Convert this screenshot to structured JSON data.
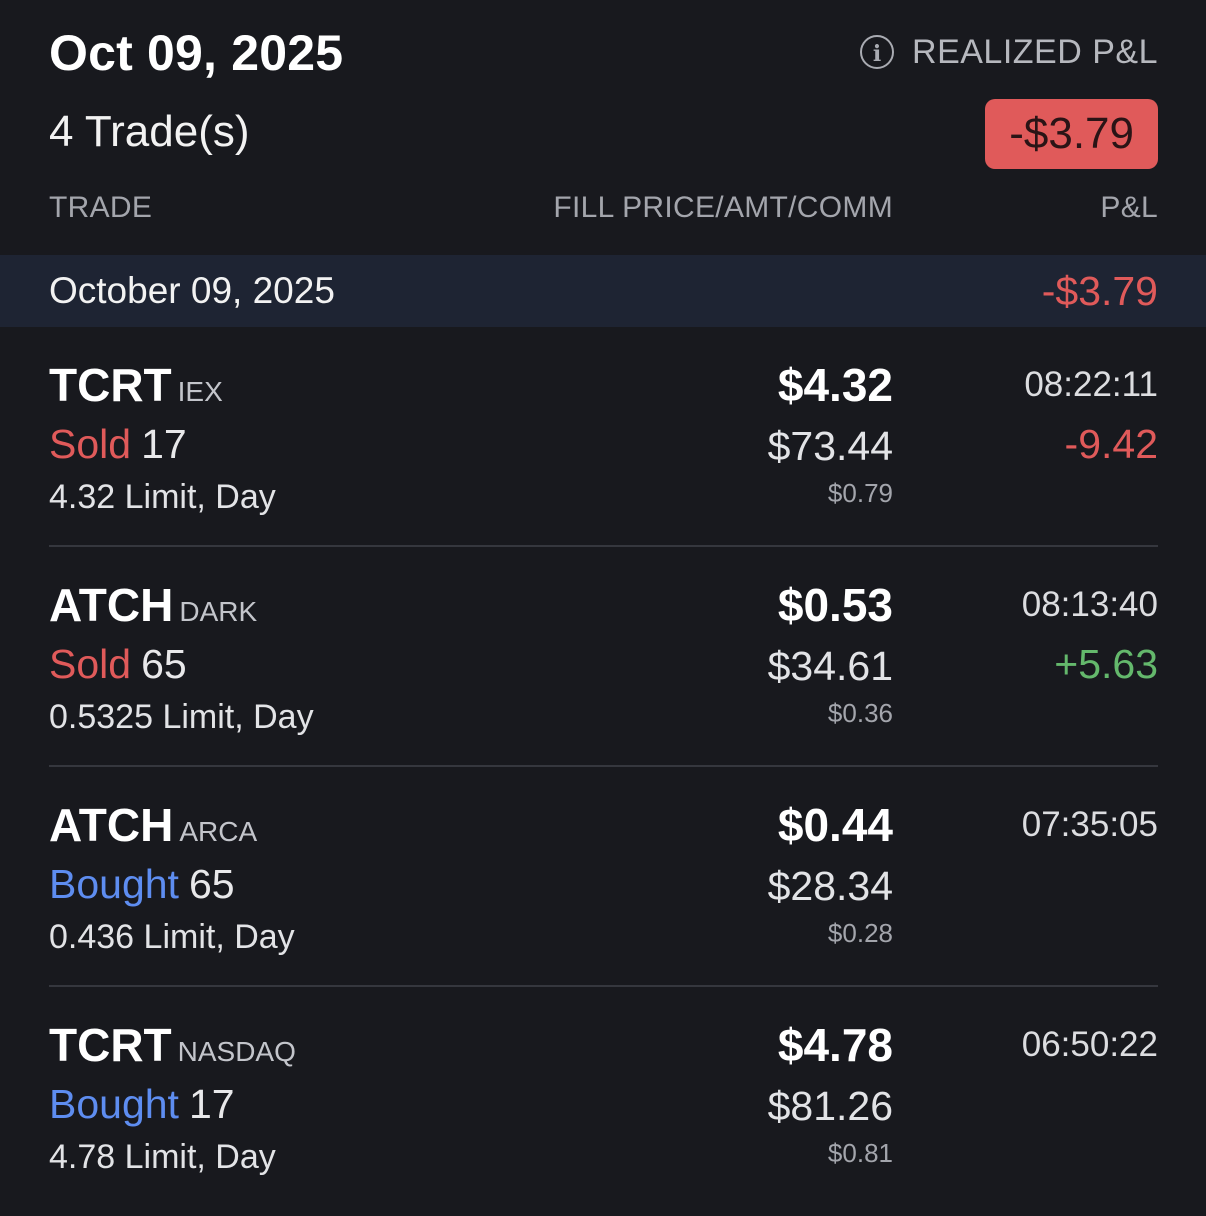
{
  "header": {
    "date": "Oct 09, 2025",
    "trade_count": "4 Trade(s)",
    "realized_label": "REALIZED P&L",
    "realized_value": "-$3.79",
    "info_icon": "info-icon"
  },
  "columns": {
    "trade": "TRADE",
    "fill": "FILL PRICE/AMT/COMM",
    "pl": "P&L"
  },
  "day_group": {
    "label": "October 09, 2025",
    "pl": "-$3.79"
  },
  "trades": [
    {
      "symbol": "TCRT",
      "exchange": "IEX",
      "side": "Sold",
      "qty": "17",
      "order": "4.32 Limit, Day",
      "fill_price": "$4.32",
      "amount": "$73.44",
      "commission": "$0.79",
      "time": "08:22:11",
      "pl": "-9.42"
    },
    {
      "symbol": "ATCH",
      "exchange": "DARK",
      "side": "Sold",
      "qty": "65",
      "order": "0.5325 Limit, Day",
      "fill_price": "$0.53",
      "amount": "$34.61",
      "commission": "$0.36",
      "time": "08:13:40",
      "pl": "+5.63"
    },
    {
      "symbol": "ATCH",
      "exchange": "ARCA",
      "side": "Bought",
      "qty": "65",
      "order": "0.436 Limit, Day",
      "fill_price": "$0.44",
      "amount": "$28.34",
      "commission": "$0.28",
      "time": "07:35:05",
      "pl": ""
    },
    {
      "symbol": "TCRT",
      "exchange": "NASDAQ",
      "side": "Bought",
      "qty": "17",
      "order": "4.78 Limit, Day",
      "fill_price": "$4.78",
      "amount": "$81.26",
      "commission": "$0.81",
      "time": "06:50:22",
      "pl": ""
    }
  ],
  "colors": {
    "background": "#18191e",
    "day_row_bg": "#1e2433",
    "negative": "#e05a5a",
    "positive": "#64b86c",
    "bought": "#5e8df0",
    "badge_bg": "#e05a5a"
  }
}
